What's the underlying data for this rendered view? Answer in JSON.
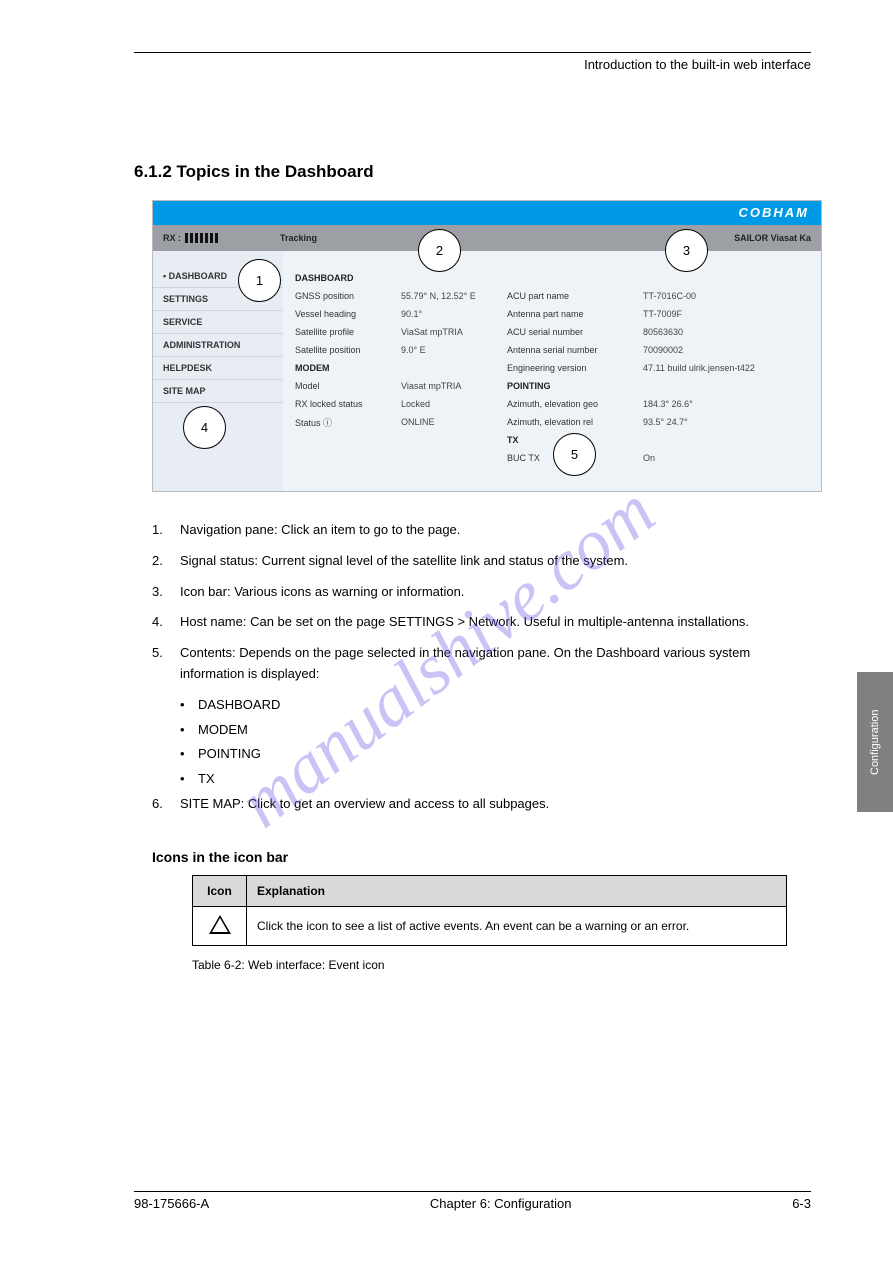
{
  "header_right": "Introduction to the built-in web interface",
  "section_number": "6.1.2   Topics in the Dashboard",
  "shot": {
    "brand": "COBHAM",
    "status": {
      "rx": "RX :",
      "tracking": "Tracking",
      "product": "SAILOR  Viasat Ka"
    },
    "sidebar": [
      "DASHBOARD",
      "SETTINGS",
      "SERVICE",
      "ADMINISTRATION",
      "HELPDESK",
      "SITE MAP"
    ],
    "dash": {
      "h1": "DASHBOARD",
      "r1l": "GNSS position",
      "r1v": "55.79° N, 12.52° E",
      "r2l": "Vessel heading",
      "r2v": "90.1°",
      "r3l": "Satellite profile",
      "r3v": "ViaSat mpTRIA",
      "r4l": "Satellite position",
      "r4v": "9.0° E",
      "h2": "MODEM",
      "r5l": "Model",
      "r5v": "Viasat mpTRIA",
      "r6l": "RX locked status",
      "r6v": "Locked",
      "r7l": "Status  ⓘ",
      "r7v": "ONLINE",
      "c1l": "ACU part name",
      "c1v": "TT-7016C-00",
      "c2l": "Antenna part name",
      "c2v": "TT-7009F",
      "c3l": "ACU serial number",
      "c3v": "80563630",
      "c4l": "Antenna serial number",
      "c4v": "70090002",
      "c5l": "Engineering version",
      "c5v": "47.11 build ulrik.jensen-t422",
      "h3": "POINTING",
      "c6l": "Azimuth, elevation geo",
      "c6v": "184.3° 26.6°",
      "c7l": "Azimuth, elevation rel",
      "c7v": "93.5° 24.7°",
      "h4": "TX",
      "c8l": "BUC TX",
      "c8v": "On"
    }
  },
  "callouts": {
    "a": "1",
    "b": "2",
    "c": "3",
    "d": "4",
    "e": "5"
  },
  "list": {
    "i1n": "1.",
    "i1": "Navigation pane: Click an item to go to the page.",
    "i2n": "2.",
    "i2": "Signal status: Current signal level of the satellite link and status of the system.",
    "i3n": "3.",
    "i3": "Icon bar: Various icons as warning or information.",
    "i4n": "4.",
    "i4": "Host name: Can be set on the page SETTINGS > Network. Useful in multiple-antenna installations.",
    "i5n": "5.",
    "i5": "Contents: Depends on the page selected in the navigation pane. On the Dashboard various system information is displayed:",
    "b1": "DASHBOARD",
    "b2": "MODEM",
    "b3": "POINTING",
    "b4": "TX",
    "i6n": "6.",
    "i6": "SITE MAP: Click to get an overview and access to all subpages."
  },
  "icons_heading": "Icons in the icon bar",
  "tbl": {
    "h1": "Icon",
    "h2": "Explanation",
    "r1": "Click the icon to see a list of active events. An event can be a warning or an error."
  },
  "tbl_caption": "Table 6-2: Web interface: Event icon",
  "side_tab": "Configuration",
  "footer": {
    "left": "98-175666-A",
    "center": "Chapter 6: Configuration",
    "right": "6-3"
  },
  "watermark": "manualshive.com"
}
